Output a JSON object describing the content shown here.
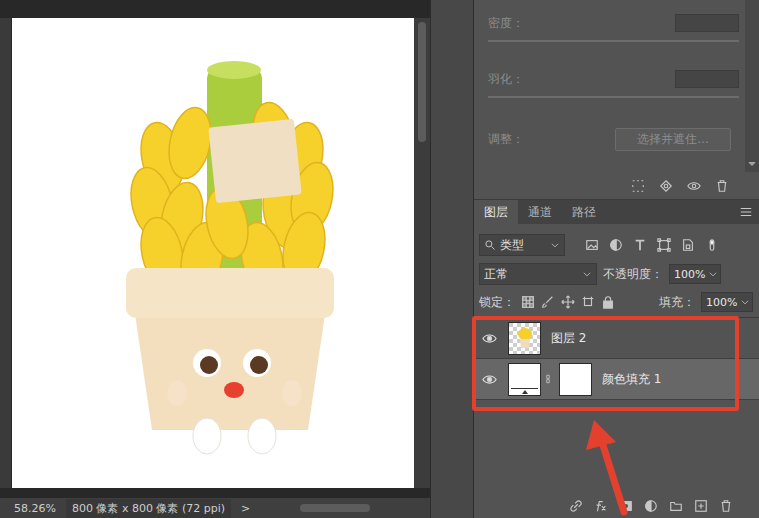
{
  "canvas": {
    "zoom": "58.26%",
    "doc_info": "800 像素 x 800 像素 (72 ppi)",
    "nav_arrow": ">"
  },
  "properties": {
    "disabled": true,
    "fields": [
      {
        "label": "密度："
      },
      {
        "label": "羽化："
      }
    ],
    "adjust_label": "调整：",
    "refine_button": "选择并遮住..."
  },
  "layers_panel": {
    "tabs": [
      {
        "label": "图层",
        "selected": true
      },
      {
        "label": "通道",
        "selected": false
      },
      {
        "label": "路径",
        "selected": false
      }
    ],
    "filter": "类型",
    "blend_mode": "正常",
    "opacity_label": "不透明度：",
    "opacity": "100%",
    "lock_label": "锁定：",
    "fill_label": "填充：",
    "fill": "100%",
    "layers": [
      {
        "name": "图层 2",
        "visible": true,
        "selected": false,
        "kind": "pixel"
      },
      {
        "name": "颜色填充 1",
        "visible": true,
        "selected": true,
        "kind": "fill"
      }
    ]
  }
}
